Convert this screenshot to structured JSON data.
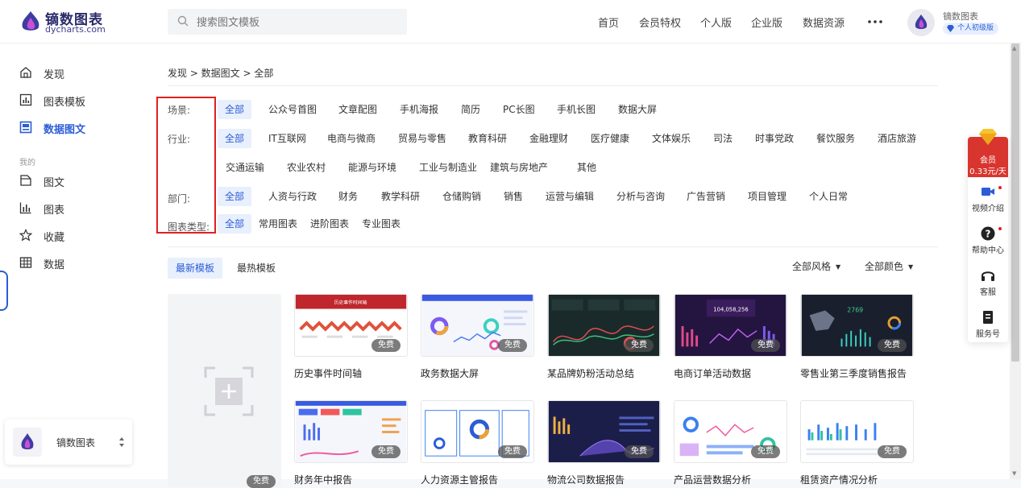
{
  "logo": {
    "name_cn": "镝数图表",
    "name_en": "dycharts.com"
  },
  "search": {
    "placeholder": "搜索图文模板"
  },
  "nav": {
    "items": [
      "首页",
      "会员特权",
      "个人版",
      "企业版",
      "数据资源"
    ],
    "more": "•••"
  },
  "user": {
    "name": "镝数图表",
    "badge": "个人初级版"
  },
  "sidebar": {
    "items": [
      {
        "label": "发现",
        "icon": "home-icon"
      },
      {
        "label": "图表模板",
        "icon": "chart-template-icon"
      },
      {
        "label": "数据图文",
        "icon": "data-article-icon",
        "active": true
      }
    ],
    "section_label": "我的",
    "my_items": [
      {
        "label": "图文",
        "icon": "article-icon"
      },
      {
        "label": "图表",
        "icon": "chart-icon"
      },
      {
        "label": "收藏",
        "icon": "star-icon"
      },
      {
        "label": "数据",
        "icon": "table-icon"
      }
    ],
    "team": {
      "name": "镝数图表"
    }
  },
  "breadcrumb": "发现 > 数据图文 > 全部",
  "filters": {
    "scene_label": "场景:",
    "scene": [
      "全部",
      "公众号首图",
      "文章配图",
      "手机海报",
      "简历",
      "PC长图",
      "手机长图",
      "数据大屏"
    ],
    "industry_label": "行业:",
    "industry_row1": [
      "全部",
      "IT互联网",
      "电商与微商",
      "贸易与零售",
      "教育科研",
      "金融理财",
      "医疗健康",
      "文体娱乐",
      "司法",
      "时事党政",
      "餐饮服务",
      "酒店旅游"
    ],
    "industry_row2": [
      "交通运输",
      "农业农村",
      "能源与环境",
      "工业与制造业",
      "建筑与房地产",
      "其他"
    ],
    "dept_label": "部门:",
    "dept": [
      "全部",
      "人资与行政",
      "财务",
      "教学科研",
      "仓储购销",
      "销售",
      "运营与编辑",
      "分析与咨询",
      "广告营销",
      "项目管理",
      "个人日常"
    ],
    "chart_type_label": "图表类型:",
    "chart_type": [
      "全部",
      "常用图表",
      "进阶图表",
      "专业图表"
    ]
  },
  "sort": {
    "tabs": [
      "最新模板",
      "最热模板"
    ],
    "style": "全部风格",
    "color": "全部颜色"
  },
  "templates": {
    "new_tag": "免费",
    "row1": [
      {
        "name": "历史事件时间轴",
        "tag": "免费"
      },
      {
        "name": "政务数据大屏",
        "tag": "免费"
      },
      {
        "name": "某品牌奶粉活动总结",
        "tag": "免费"
      },
      {
        "name": "电商订单活动数据",
        "tag": "免费"
      },
      {
        "name": "零售业第三季度销售报告",
        "tag": "免费"
      }
    ],
    "row2": [
      {
        "name": "财务年中报告",
        "tag": "免费"
      },
      {
        "name": "人力资源主管报告",
        "tag": "免费"
      },
      {
        "name": "物流公司数据报告",
        "tag": "免费"
      },
      {
        "name": "产品运营数据分析",
        "tag": "免费"
      },
      {
        "name": "租赁资产情况分析",
        "tag": "免费"
      }
    ],
    "thumb_texts": {
      "t1_title": "历史事件时间轴",
      "t4_number": "104,058,256",
      "t5_number": "2769"
    }
  },
  "float_panel": {
    "vip_label": "会员",
    "vip_price": "0.33元/天",
    "items": [
      "视频介绍",
      "帮助中心",
      "客服",
      "服务号"
    ]
  },
  "colors": {
    "accent": "#2b5dd6",
    "highlight_box": "#e02020",
    "vip": "#d9352f"
  }
}
